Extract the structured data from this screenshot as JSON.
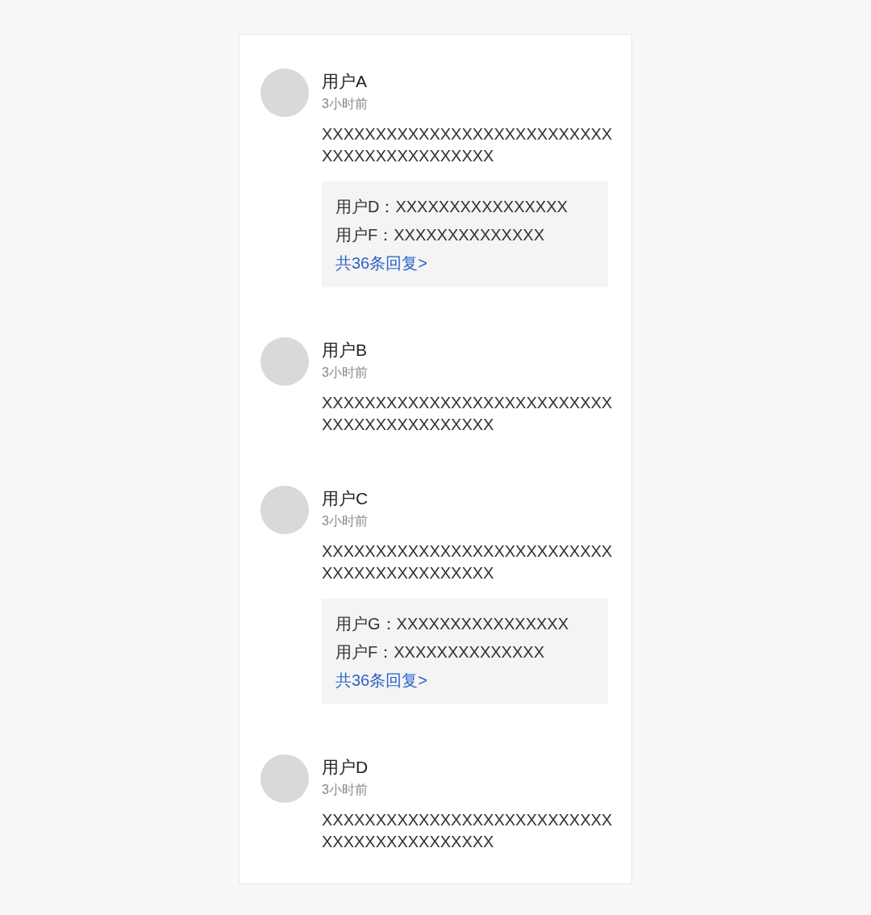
{
  "comments": [
    {
      "user": "用户A",
      "time": "3小时前",
      "text": "XXXXXXXXXXXXXXXXXXXXXXXXXXXXXXXXXXXXXXXXXXX",
      "replies": [
        {
          "user": "用户D：",
          "text": "XXXXXXXXXXXXXXXX"
        },
        {
          "user": "用户F：",
          "text": "XXXXXXXXXXXXXX"
        }
      ],
      "more": "共36条回复>"
    },
    {
      "user": "用户B",
      "time": "3小时前",
      "text": "XXXXXXXXXXXXXXXXXXXXXXXXXXXXXXXXXXXXXXXXXXX"
    },
    {
      "user": "用户C",
      "time": "3小时前",
      "text": "XXXXXXXXXXXXXXXXXXXXXXXXXXXXXXXXXXXXXXXXXXX",
      "replies": [
        {
          "user": "用户G：",
          "text": "XXXXXXXXXXXXXXXX"
        },
        {
          "user": "用户F：",
          "text": "XXXXXXXXXXXXXX"
        }
      ],
      "more": "共36条回复>"
    },
    {
      "user": "用户D",
      "time": "3小时前",
      "text": "XXXXXXXXXXXXXXXXXXXXXXXXXXXXXXXXXXXXXXXXXXX"
    }
  ]
}
